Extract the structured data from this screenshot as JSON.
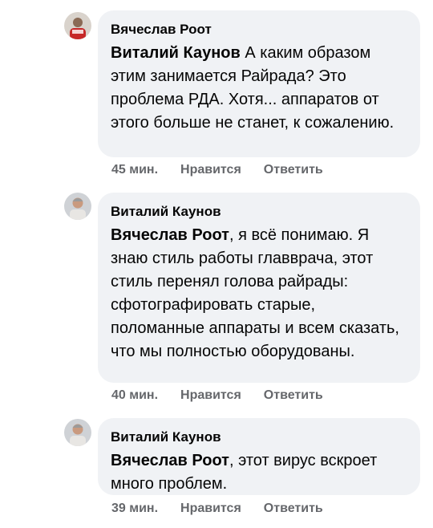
{
  "comments": [
    {
      "author": "Вячеслав Роот",
      "mention": "Виталий Каунов",
      "text": " А каким образом этим занимается Райрада? Это проблема РДА. Хотя... аппаратов от этого больше не станет, к сожалению.",
      "time": "45 мин.",
      "like": "Нравится",
      "reply": "Ответить",
      "avatar_icon": "user-avatar-red-icon"
    },
    {
      "author": "Виталий Каунов",
      "mention": "Вячеслав Роот",
      "text": ", я всё понимаю. Я знаю стиль работы главврача, этот стиль перенял голова райрады: сфотографировать старые, поломанные аппараты и всем сказать, что мы полностью оборудованы.",
      "time": "40 мин.",
      "like": "Нравится",
      "reply": "Ответить",
      "avatar_icon": "user-avatar-photo-icon"
    },
    {
      "author": "Виталий Каунов",
      "mention": "Вячеслав Роот",
      "text": ", этот вирус вскроет много проблем.",
      "time": "39 мин.",
      "like": "Нравится",
      "reply": "Ответить",
      "avatar_icon": "user-avatar-photo-icon"
    }
  ],
  "colors": {
    "bubble": "#f0f2f5",
    "meta": "#65676b",
    "text": "#050505"
  }
}
